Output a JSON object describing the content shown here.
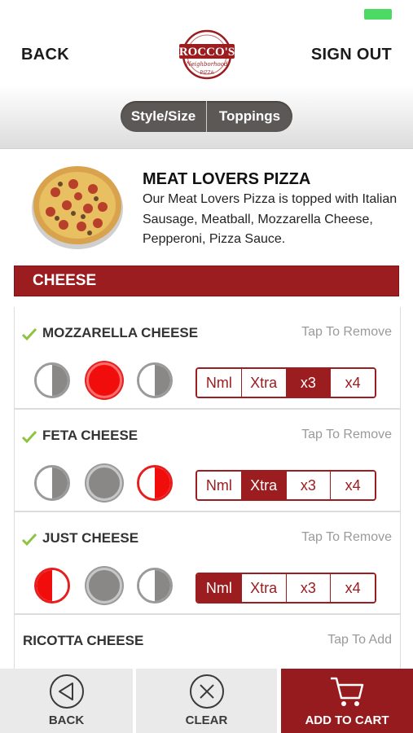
{
  "header": {
    "back_label": "BACK",
    "signout_label": "SIGN OUT"
  },
  "logo": {
    "name": "ROCCO'S",
    "script": "Neighborhood",
    "sub": "PIZZA"
  },
  "tabs": [
    {
      "label": "Style/Size"
    },
    {
      "label": "Toppings"
    }
  ],
  "product": {
    "title": "MEAT LOVERS PIZZA",
    "description": "Our Meat Lovers Pizza is topped with Italian Sausage, Meatball, Mozzarella Cheese, Pepperoni, Pizza Sauce."
  },
  "section": {
    "title": "CHEESE"
  },
  "toppings": [
    {
      "name": "MOZZARELLA CHEESE",
      "checked": true,
      "action": "Tap To Remove",
      "coverage": "whole",
      "amount": "x3"
    },
    {
      "name": "FETA CHEESE",
      "checked": true,
      "action": "Tap To Remove",
      "coverage": "right",
      "amount": "Xtra"
    },
    {
      "name": "JUST CHEESE",
      "checked": true,
      "action": "Tap To Remove",
      "coverage": "left",
      "amount": "Nml"
    },
    {
      "name": "RICOTTA CHEESE",
      "checked": false,
      "action": "Tap To Add"
    }
  ],
  "amount_options": [
    "Nml",
    "Xtra",
    "x3",
    "x4"
  ],
  "bottom": {
    "back_label": "BACK",
    "clear_label": "CLEAR",
    "cart_label": "ADD TO CART"
  },
  "colors": {
    "accent": "#9b1d20",
    "selected_red": "#f20d0d",
    "check_green": "#8cc43f"
  },
  "icons": [
    "back-circle-icon",
    "clear-x-icon",
    "cart-icon",
    "checkmark-icon",
    "pizza-image"
  ]
}
